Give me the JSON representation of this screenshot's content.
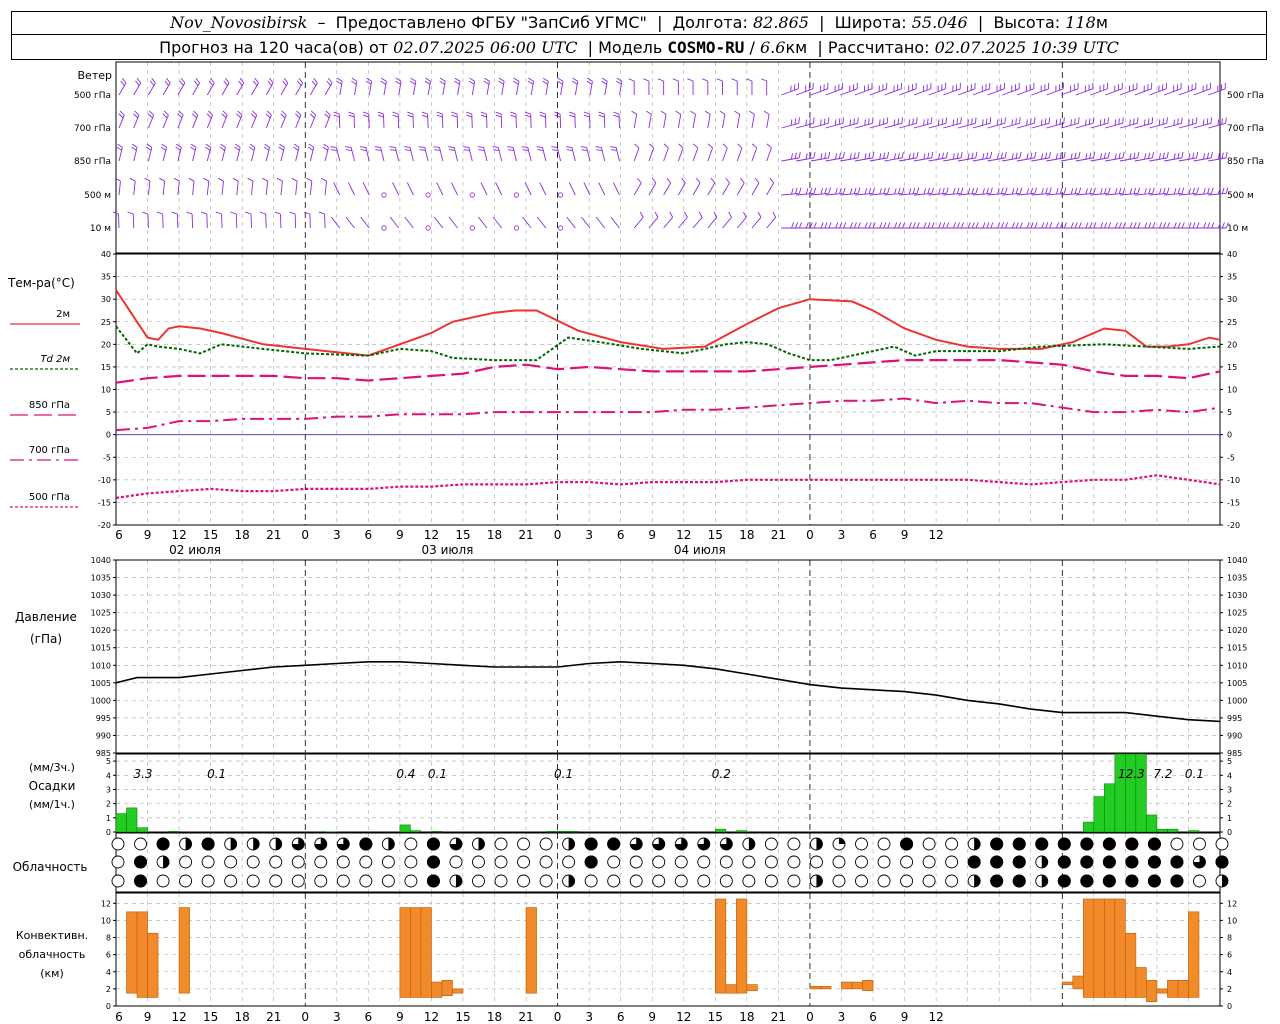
{
  "header": {
    "station": "Nov_Novosibirsk",
    "provider": "Предоставлено ФГБУ \"ЗапСиб УГМС\"",
    "lon_label": "Долгота:",
    "lon_value": "82.865",
    "lat_label": "Широта:",
    "lat_value": "55.046",
    "alt_label": "Высота:",
    "alt_value": "118",
    "alt_unit": "м",
    "forecast_label": "Прогноз на 120 часа(ов)",
    "from_label": "от",
    "start_time": "02.07.2025 06:00 UTC",
    "model_label": "Модель",
    "model_name": "COSMO-RU",
    "model_res": "6.6",
    "model_res_unit": "км",
    "computed_label": "Рассчитано:",
    "computed_time": "02.07.2025 10:39 UTC"
  },
  "time_axis": {
    "hours": [
      "6",
      "9",
      "12",
      "15",
      "18",
      "21",
      "0",
      "3",
      "6",
      "9",
      "12",
      "15",
      "18",
      "21",
      "0",
      "3",
      "6",
      "9",
      "12",
      "15",
      "18",
      "21",
      "0",
      "3",
      "6",
      "9",
      "12"
    ],
    "day_labels": [
      "02 июля",
      "03 июля",
      "04 июля"
    ]
  },
  "wind_panel": {
    "title": "Ветер",
    "levels": [
      "500 гПа",
      "700 гПа",
      "850 гПа",
      "500 м",
      "10 м"
    ]
  },
  "temp_panel": {
    "title": "Тем-ра(°C)",
    "legend": [
      {
        "label": "2м",
        "color": "#ee3333"
      },
      {
        "label": "Td  2м",
        "color": "#006600"
      },
      {
        "label": "850 гПа",
        "color": "#dd1177"
      },
      {
        "label": "700 гПа",
        "color": "#dd1177"
      },
      {
        "label": "500 гПа",
        "color": "#dd1177"
      }
    ],
    "y_ticks": [
      "40",
      "35",
      "30",
      "25",
      "20",
      "15",
      "10",
      "5",
      "0",
      "-5",
      "-10",
      "-15",
      "-20"
    ]
  },
  "pressure_panel": {
    "title": "Давление",
    "unit": "(гПа)",
    "y_ticks": [
      "1040",
      "1035",
      "1030",
      "1025",
      "1020",
      "1015",
      "1010",
      "1005",
      "1000",
      "995",
      "990",
      "985"
    ]
  },
  "precip_panel": {
    "unit_3h": "(мм/3ч.)",
    "title": "Осадки",
    "unit_1h": "(мм/1ч.)",
    "y_ticks": [
      "5",
      "4",
      "3",
      "2",
      "1",
      "0"
    ],
    "totals": [
      {
        "hour": 2,
        "label": "3.3"
      },
      {
        "hour": 9,
        "label": "0.1"
      },
      {
        "hour": 27,
        "label": "0.4"
      },
      {
        "hour": 30,
        "label": "0.1"
      },
      {
        "hour": 42,
        "label": "0.1"
      },
      {
        "hour": 57,
        "label": "0.2"
      },
      {
        "hour": 96,
        "label": "12.3"
      },
      {
        "hour": 99,
        "label": "7.2"
      },
      {
        "hour": 102,
        "label": "0.1"
      }
    ]
  },
  "cloud_panel": {
    "title": "Облачность"
  },
  "conv_panel": {
    "title_1": "Конвективн.",
    "title_2": "облачность",
    "unit": "(км)",
    "y_ticks": [
      "12",
      "10",
      "8",
      "6",
      "4",
      "2",
      "0"
    ]
  },
  "chart_data": [
    {
      "type": "line",
      "title": "Тем-ра(°C)",
      "x_unit": "hours since 02.07.2025 06 UTC",
      "ylim": [
        -20,
        40
      ],
      "series": [
        {
          "name": "2м",
          "x": [
            0,
            2,
            3,
            4,
            5,
            6,
            8,
            10,
            14,
            18,
            24,
            27,
            30,
            32,
            34,
            36,
            38,
            40,
            44,
            48,
            52,
            56,
            60,
            63,
            66,
            70,
            72,
            75,
            78,
            81,
            84,
            88,
            91,
            94,
            96,
            98,
            99,
            100,
            102,
            104,
            105
          ],
          "values": [
            32,
            25,
            21.5,
            21,
            23.5,
            24,
            23.5,
            22.5,
            20,
            19,
            17.5,
            20,
            22.5,
            25,
            26,
            27,
            27.5,
            27.5,
            23,
            20.5,
            19,
            19.5,
            24.5,
            28,
            30,
            29.5,
            27.5,
            23.5,
            21,
            19.5,
            19,
            19,
            20.5,
            23.5,
            23,
            19.5,
            19.5,
            19.5,
            20,
            21.5,
            21
          ]
        },
        {
          "name": "Td  2м",
          "x": [
            0,
            2,
            3,
            4,
            6,
            8,
            10,
            14,
            18,
            24,
            27,
            30,
            32,
            36,
            40,
            43,
            46,
            50,
            54,
            58,
            60,
            62,
            64,
            66,
            68,
            72,
            74,
            76,
            78,
            80,
            84,
            88,
            94,
            98,
            102,
            105
          ],
          "values": [
            24,
            18,
            20,
            19.5,
            19,
            18,
            20,
            19,
            18,
            17.5,
            19,
            18.5,
            17,
            16.5,
            16.5,
            21.5,
            20.5,
            19,
            18,
            20,
            20.5,
            20,
            18,
            16.5,
            16.5,
            18.5,
            19.5,
            17.5,
            18.5,
            18.5,
            18.5,
            19.5,
            20,
            19.5,
            19,
            19.5
          ]
        },
        {
          "name": "850 гПа",
          "x": [
            0,
            3,
            6,
            9,
            12,
            15,
            18,
            21,
            24,
            27,
            30,
            33,
            36,
            39,
            42,
            45,
            48,
            51,
            54,
            57,
            60,
            63,
            66,
            69,
            72,
            75,
            78,
            81,
            84,
            87,
            90,
            93,
            96,
            99,
            102,
            105
          ],
          "values": [
            11.5,
            12.5,
            13,
            13,
            13,
            13,
            12.5,
            12.5,
            12,
            12.5,
            13,
            13.5,
            15,
            15.5,
            14.5,
            15,
            14.5,
            14,
            14,
            14,
            14,
            14.5,
            15,
            15.5,
            16,
            16.5,
            16.5,
            16.5,
            16.5,
            16,
            15.5,
            14,
            13,
            13,
            12.5,
            14
          ]
        },
        {
          "name": "700 гПа",
          "x": [
            0,
            3,
            6,
            9,
            12,
            15,
            18,
            21,
            24,
            27,
            30,
            33,
            36,
            39,
            42,
            45,
            48,
            51,
            54,
            57,
            60,
            63,
            66,
            69,
            72,
            75,
            78,
            81,
            84,
            87,
            90,
            93,
            96,
            99,
            102,
            105
          ],
          "values": [
            1,
            1.5,
            3,
            3,
            3.5,
            3.5,
            3.5,
            4,
            4,
            4.5,
            4.5,
            4.5,
            5,
            5,
            5,
            5,
            5,
            5,
            5.5,
            5.5,
            6,
            6.5,
            7,
            7.5,
            7.5,
            8,
            7,
            7.5,
            7,
            7,
            6,
            5,
            5,
            5.5,
            5,
            6
          ]
        },
        {
          "name": "500 гПа",
          "x": [
            0,
            3,
            6,
            9,
            12,
            15,
            18,
            21,
            24,
            27,
            30,
            33,
            36,
            39,
            42,
            45,
            48,
            51,
            54,
            57,
            60,
            63,
            66,
            69,
            72,
            75,
            78,
            81,
            84,
            87,
            90,
            93,
            96,
            99,
            102,
            105
          ],
          "values": [
            -14,
            -13,
            -12.5,
            -12,
            -12.5,
            -12.5,
            -12,
            -12,
            -12,
            -11.5,
            -11.5,
            -11,
            -11,
            -11,
            -10.5,
            -10.5,
            -11,
            -10.5,
            -10.5,
            -10.5,
            -10,
            -10,
            -10,
            -10,
            -10,
            -10,
            -10,
            -10,
            -10.5,
            -11,
            -10.5,
            -10,
            -10,
            -9,
            -10,
            -11
          ]
        }
      ]
    },
    {
      "type": "line",
      "title": "Давление",
      "x_unit": "hours since 02.07.2025 06 UTC",
      "ylim": [
        985,
        1040
      ],
      "series": [
        {
          "name": "",
          "x": [
            0,
            2,
            4,
            6,
            9,
            12,
            15,
            18,
            21,
            24,
            27,
            30,
            33,
            36,
            39,
            42,
            45,
            48,
            51,
            54,
            57,
            60,
            63,
            66,
            69,
            72,
            75,
            78,
            81,
            84,
            87,
            90,
            93,
            96,
            99,
            102,
            105
          ],
          "values": [
            1005,
            1006.5,
            1006.5,
            1006.5,
            1007.5,
            1008.5,
            1009.5,
            1010,
            1010.5,
            1011,
            1011,
            1010.5,
            1010,
            1009.5,
            1009.5,
            1009.5,
            1010.5,
            1011,
            1010.5,
            1010,
            1009,
            1007.5,
            1006,
            1004.5,
            1003.5,
            1003,
            1002.5,
            1001.5,
            1000,
            999,
            997.5,
            996.5,
            996.5,
            996.5,
            995.5,
            994.5,
            994
          ]
        }
      ]
    },
    {
      "type": "bar",
      "title": "Осадки",
      "x_unit": "hours since 02.07.2025 06 UTC",
      "ylim": [
        0,
        5
      ],
      "x": [
        0,
        1,
        2,
        5,
        20,
        27,
        28,
        30,
        41,
        42,
        43,
        57,
        59,
        92,
        93,
        94,
        95,
        96,
        97,
        98,
        99,
        100,
        102
      ],
      "values": [
        1.3,
        1.7,
        0.3,
        0.05,
        0.02,
        0.5,
        0.1,
        0.05,
        0.05,
        0.05,
        0.05,
        0.2,
        0.1,
        0.7,
        2.5,
        3.4,
        5.5,
        5.5,
        5.5,
        1.2,
        0.2,
        0.2,
        0.1
      ]
    },
    {
      "type": "bar",
      "title": "Конвективн. облачность",
      "x_unit": "hours since 02.07.2025 06 UTC",
      "ylim": [
        0,
        13
      ],
      "bars": [
        {
          "x": 1,
          "base": 1.5,
          "top": 11
        },
        {
          "x": 2,
          "base": 1,
          "top": 11
        },
        {
          "x": 3,
          "base": 1,
          "top": 8.5
        },
        {
          "x": 6,
          "base": 1.5,
          "top": 11.5
        },
        {
          "x": 27,
          "base": 1,
          "top": 11.5
        },
        {
          "x": 28,
          "base": 1,
          "top": 11.5
        },
        {
          "x": 29,
          "base": 1,
          "top": 11.5
        },
        {
          "x": 30,
          "base": 1,
          "top": 2.8
        },
        {
          "x": 31,
          "base": 1.2,
          "top": 3
        },
        {
          "x": 32,
          "base": 1.5,
          "top": 2
        },
        {
          "x": 39,
          "base": 1.5,
          "top": 11.5
        },
        {
          "x": 57,
          "base": 1.5,
          "top": 12.5
        },
        {
          "x": 58,
          "base": 1.5,
          "top": 2.5
        },
        {
          "x": 59,
          "base": 1.5,
          "top": 12.5
        },
        {
          "x": 60,
          "base": 1.8,
          "top": 2.5
        },
        {
          "x": 66,
          "base": 2,
          "top": 2.3
        },
        {
          "x": 67,
          "base": 2,
          "top": 2.3
        },
        {
          "x": 69,
          "base": 2,
          "top": 2.8
        },
        {
          "x": 70,
          "base": 2,
          "top": 2.8
        },
        {
          "x": 71,
          "base": 1.8,
          "top": 3
        },
        {
          "x": 90,
          "base": 2.5,
          "top": 2.8
        },
        {
          "x": 91,
          "base": 2,
          "top": 3.5
        },
        {
          "x": 92,
          "base": 1,
          "top": 12.5
        },
        {
          "x": 93,
          "base": 1,
          "top": 12.5
        },
        {
          "x": 94,
          "base": 1,
          "top": 12.5
        },
        {
          "x": 95,
          "base": 1,
          "top": 12.5
        },
        {
          "x": 96,
          "base": 1,
          "top": 8.5
        },
        {
          "x": 97,
          "base": 1,
          "top": 4.5
        },
        {
          "x": 98,
          "base": 0.5,
          "top": 3
        },
        {
          "x": 99,
          "base": 1.5,
          "top": 2
        },
        {
          "x": 100,
          "base": 1,
          "top": 3
        },
        {
          "x": 101,
          "base": 1,
          "top": 3
        },
        {
          "x": 102,
          "base": 1,
          "top": 11
        }
      ]
    },
    {
      "type": "table",
      "title": "Облачность",
      "note": "cloud cover fraction in eighths per 3 hours, three layers",
      "rows": [
        [
          0,
          0,
          8,
          4,
          8,
          4,
          4,
          4,
          6,
          6,
          6,
          8,
          4,
          0,
          8,
          6,
          4,
          0,
          0,
          0,
          4,
          8,
          8,
          6,
          6,
          6,
          6,
          6,
          4,
          0,
          0,
          4,
          2,
          0,
          0,
          8,
          0,
          0,
          4,
          8,
          8,
          8,
          8,
          8,
          8,
          8,
          8,
          0,
          0,
          0
        ],
        [
          0,
          8,
          4,
          0,
          0,
          0,
          0,
          0,
          0,
          0,
          0,
          0,
          0,
          0,
          8,
          0,
          0,
          0,
          0,
          0,
          0,
          8,
          0,
          0,
          0,
          0,
          0,
          0,
          0,
          0,
          0,
          0,
          0,
          0,
          0,
          0,
          0,
          0,
          8,
          8,
          8,
          4,
          8,
          8,
          8,
          8,
          8,
          8,
          6,
          8
        ],
        [
          0,
          8,
          0,
          0,
          0,
          0,
          0,
          0,
          0,
          0,
          0,
          0,
          0,
          0,
          8,
          4,
          0,
          0,
          0,
          0,
          4,
          0,
          0,
          0,
          0,
          0,
          0,
          0,
          0,
          0,
          0,
          4,
          0,
          0,
          0,
          0,
          0,
          0,
          4,
          8,
          8,
          4,
          8,
          8,
          8,
          8,
          8,
          8,
          0,
          4
        ]
      ]
    }
  ]
}
